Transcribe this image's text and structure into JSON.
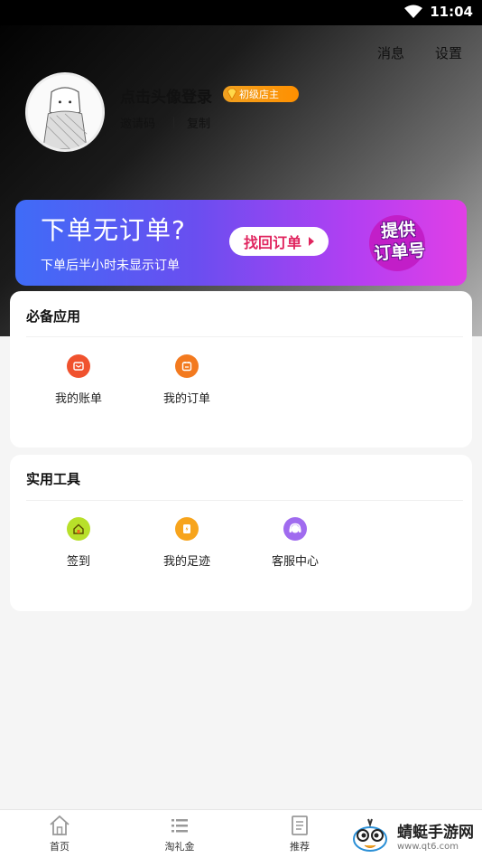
{
  "status": {
    "time": "11:04"
  },
  "header": {
    "messages_label": "消息",
    "settings_label": "设置"
  },
  "profile": {
    "login_text": "点击头像登录",
    "level_badge": "初级店主",
    "invite_label": "邀请码",
    "copy_label": "复制"
  },
  "banner": {
    "title": "下单无订单?",
    "subtitle": "下单后半小时未显示订单",
    "button_label": "找回订单",
    "stamp_line1": "提供",
    "stamp_line2": "订单号"
  },
  "essential_apps": {
    "title": "必备应用",
    "items": [
      {
        "label": "我的账单",
        "icon": "bill-icon",
        "color": "#f0522e"
      },
      {
        "label": "我的订单",
        "icon": "order-icon",
        "color": "#f37a1f"
      }
    ]
  },
  "tools": {
    "title": "实用工具",
    "items": [
      {
        "label": "签到",
        "icon": "checkin-home-icon",
        "color": "#b8e02a"
      },
      {
        "label": "我的足迹",
        "icon": "footprint-icon",
        "color": "#f7a41c"
      },
      {
        "label": "客服中心",
        "icon": "customer-service-icon",
        "color": "#a06bef"
      }
    ]
  },
  "tabbar": {
    "items": [
      {
        "label": "首页",
        "icon": "home-icon"
      },
      {
        "label": "淘礼金",
        "icon": "list-icon"
      },
      {
        "label": "推荐",
        "icon": "document-icon"
      }
    ]
  },
  "watermark": {
    "name": "蜻蜓手游网",
    "url": "www.qt6.com"
  }
}
